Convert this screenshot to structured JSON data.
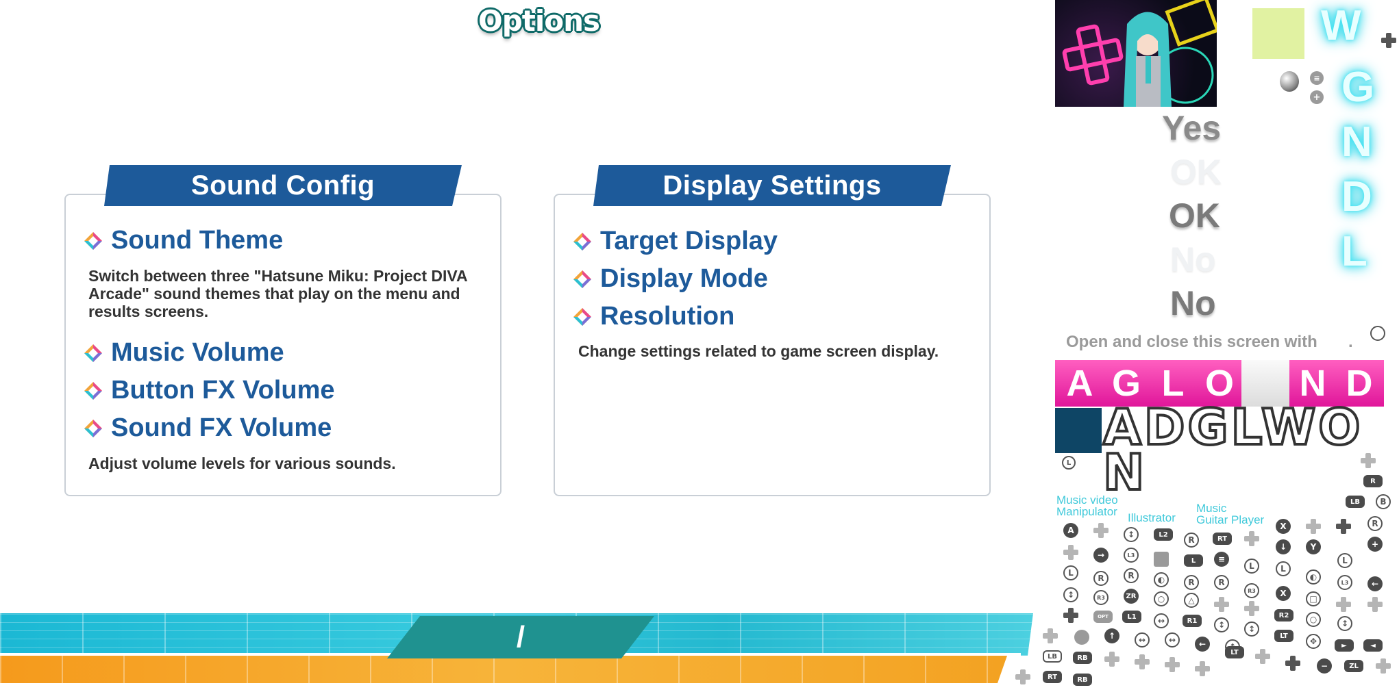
{
  "header": {
    "title": "Options"
  },
  "sound_panel": {
    "title": "Sound Config",
    "items": [
      {
        "label": "Sound Theme"
      },
      {
        "label": "Music Volume"
      },
      {
        "label": "Button FX Volume"
      },
      {
        "label": "Sound FX Volume"
      }
    ],
    "theme_description": "Switch between three \"Hatsune Miku: Project DIVA Arcade\" sound themes that play on the menu and results screens.",
    "volume_description": "Adjust volume levels for various sounds."
  },
  "display_panel": {
    "title": "Display Settings",
    "items": [
      {
        "label": "Target Display"
      },
      {
        "label": "Display Mode"
      },
      {
        "label": "Resolution"
      }
    ],
    "description": "Change settings related to game screen display."
  },
  "page_indicator": {
    "text": "/"
  },
  "sprites": {
    "yes": "Yes",
    "ok_faded": "OK",
    "ok": "OK",
    "no_faded": "No",
    "no": "No",
    "neon_letters": [
      "W",
      "G",
      "N",
      "D",
      "L"
    ],
    "hint": "Open and close this screen with",
    "hint_dot": ".",
    "pink_letters": [
      "A",
      "G",
      "L",
      "O",
      "N",
      "D"
    ],
    "outline_text": "ADGLWO",
    "outline_text_2": "N",
    "credit_1": "Music video\nManipulator",
    "credit_2": "Illustrator",
    "credit_3": "Music\nGuitar Player",
    "btn_labels": [
      "A",
      "L3",
      "R",
      "RT",
      "X",
      "Y",
      "L",
      "R3",
      "ZR",
      "L1",
      "R1",
      "R2",
      "LT",
      "LB",
      "RB",
      "ZL",
      "B",
      "L2"
    ]
  },
  "colors": {
    "accent_blue": "#1d5a9a",
    "teal": "#1f9290",
    "cyan_band": "#24b9d0",
    "orange_band": "#f5a022",
    "pink": "#e0169a"
  }
}
